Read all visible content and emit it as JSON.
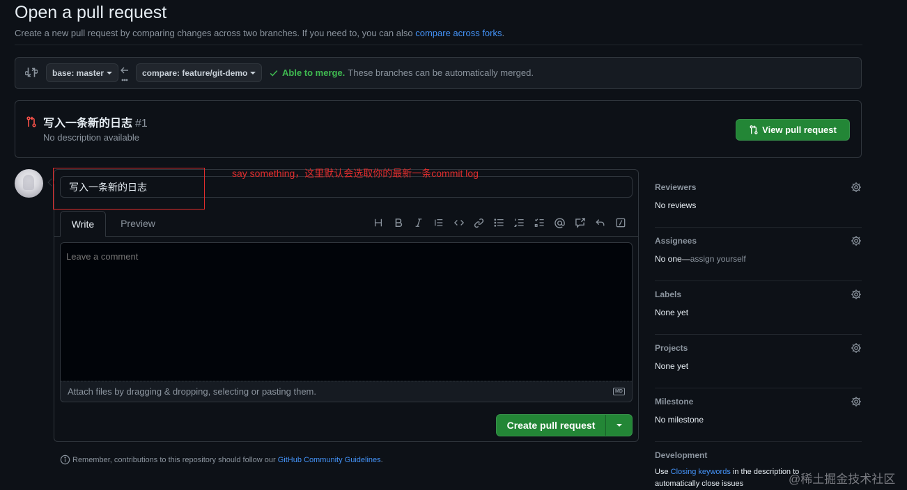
{
  "page": {
    "title": "Open a pull request",
    "subtitle": "Create a new pull request by comparing changes across two branches. If you need to, you can also",
    "subtitle_link": "compare across forks",
    "subtitle_end": "."
  },
  "range": {
    "base_label": "base: master",
    "compare_label": "compare: feature/git-demo",
    "merge_ok": "Able to merge.",
    "merge_text": "These branches can be automatically merged."
  },
  "existing_pr": {
    "title": "写入一条新的日志",
    "number": "#1",
    "description": "No description available",
    "view_button": "View pull request"
  },
  "form": {
    "title_value": "写入一条新的日志",
    "tab_write": "Write",
    "tab_preview": "Preview",
    "comment_placeholder": "Leave a comment",
    "attach_text": "Attach files by dragging & dropping, selecting or pasting them.",
    "md_badge": "MD",
    "create_button": "Create pull request",
    "toolbar_icons": [
      "heading-icon",
      "bold-icon",
      "italic-icon",
      "quote-icon",
      "code-icon",
      "link-icon",
      "unordered-list-icon",
      "ordered-list-icon",
      "task-list-icon",
      "mention-icon",
      "cross-reference-icon",
      "reply-icon",
      "slash-command-icon"
    ]
  },
  "guidelines": {
    "prefix": "Remember, contributions to this repository should follow our",
    "link": "GitHub Community Guidelines",
    "suffix": "."
  },
  "sidebar": {
    "reviewers_head": "Reviewers",
    "reviewers_val": "No reviews",
    "assignees_head": "Assignees",
    "assignees_val": "No one—",
    "assignees_link": "assign yourself",
    "labels_head": "Labels",
    "labels_val": "None yet",
    "projects_head": "Projects",
    "projects_val": "None yet",
    "milestone_head": "Milestone",
    "milestone_val": "No milestone",
    "development_head": "Development",
    "dev_prefix": "Use",
    "dev_link": "Closing keywords",
    "dev_suffix": "in the description to automatically close issues"
  },
  "annotation": {
    "text": "say something，这里默认会选取你的最新一条commit log",
    "color": "#e02d2d"
  },
  "watermark": "@稀土掘金技术社区",
  "colors": {
    "accent": "#4493f8",
    "green": "#238636",
    "success_text": "#3fb950",
    "pr_open_icon": "#f85149"
  }
}
